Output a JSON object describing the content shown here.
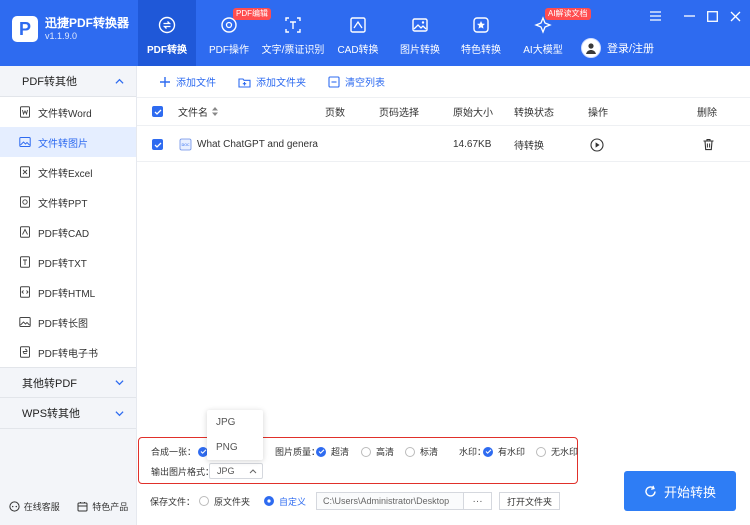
{
  "app": {
    "title": "迅捷PDF转换器",
    "version": "v1.1.9.0"
  },
  "nav": [
    {
      "label": "PDF转换",
      "icon": "convert-icon",
      "active": true
    },
    {
      "label": "PDF操作",
      "icon": "pdf-operate-icon",
      "badge": "PDF编辑"
    },
    {
      "label": "文字/票证识别",
      "icon": "ocr-icon"
    },
    {
      "label": "CAD转换",
      "icon": "cad-icon"
    },
    {
      "label": "图片转换",
      "icon": "image-icon"
    },
    {
      "label": "特色转换",
      "icon": "special-icon"
    },
    {
      "label": "AI大模型",
      "icon": "ai-icon",
      "badge": "AI解读文档"
    }
  ],
  "user": {
    "label": "登录/注册"
  },
  "sidebar": {
    "sections": [
      {
        "title": "PDF转其他",
        "expanded": true
      },
      {
        "title": "其他转PDF",
        "expanded": false
      },
      {
        "title": "WPS转其他",
        "expanded": false
      }
    ],
    "items": [
      {
        "label": "文件转Word",
        "icon": "word-icon"
      },
      {
        "label": "文件转图片",
        "icon": "picture-icon",
        "active": true
      },
      {
        "label": "文件转Excel",
        "icon": "excel-icon"
      },
      {
        "label": "文件转PPT",
        "icon": "ppt-icon"
      },
      {
        "label": "PDF转CAD",
        "icon": "cad-file-icon"
      },
      {
        "label": "PDF转TXT",
        "icon": "txt-icon"
      },
      {
        "label": "PDF转HTML",
        "icon": "html-icon"
      },
      {
        "label": "PDF转长图",
        "icon": "long-image-icon"
      },
      {
        "label": "PDF转电子书",
        "icon": "ebook-icon"
      }
    ],
    "footer": {
      "service": "在线客服",
      "products": "特色产品"
    }
  },
  "toolbar": {
    "add_file": "添加文件",
    "add_folder": "添加文件夹",
    "clear_list": "清空列表"
  },
  "table": {
    "headers": {
      "name": "文件名",
      "pages": "页数",
      "page_select": "页码选择",
      "size": "原始大小",
      "status": "转换状态",
      "action": "操作",
      "delete": "删除"
    },
    "rows": [
      {
        "name": "What ChatGPT and genera",
        "pages": "",
        "page_select": "",
        "size": "14.67KB",
        "status": "待转换"
      }
    ]
  },
  "dropdown": {
    "options": [
      "JPG",
      "PNG"
    ]
  },
  "options": {
    "merge_label": "合成一张：",
    "quality_label": "图片质量：",
    "quality_options": [
      "超清",
      "高清",
      "标清"
    ],
    "watermark_label": "水印：",
    "watermark_options": [
      "有水印",
      "无水印"
    ],
    "format_label": "输出图片格式：",
    "format_value": "JPG"
  },
  "save": {
    "label": "保存文件：",
    "original_folder": "原文件夹",
    "custom": "自定义",
    "path": "C:\\Users\\Administrator\\Desktop",
    "browse": "···",
    "open_folder": "打开文件夹"
  },
  "start_button": "开始转换",
  "colors": {
    "primary": "#2e6bf0",
    "highlight_border": "#e0302a",
    "badge": "#ff4d4f"
  }
}
